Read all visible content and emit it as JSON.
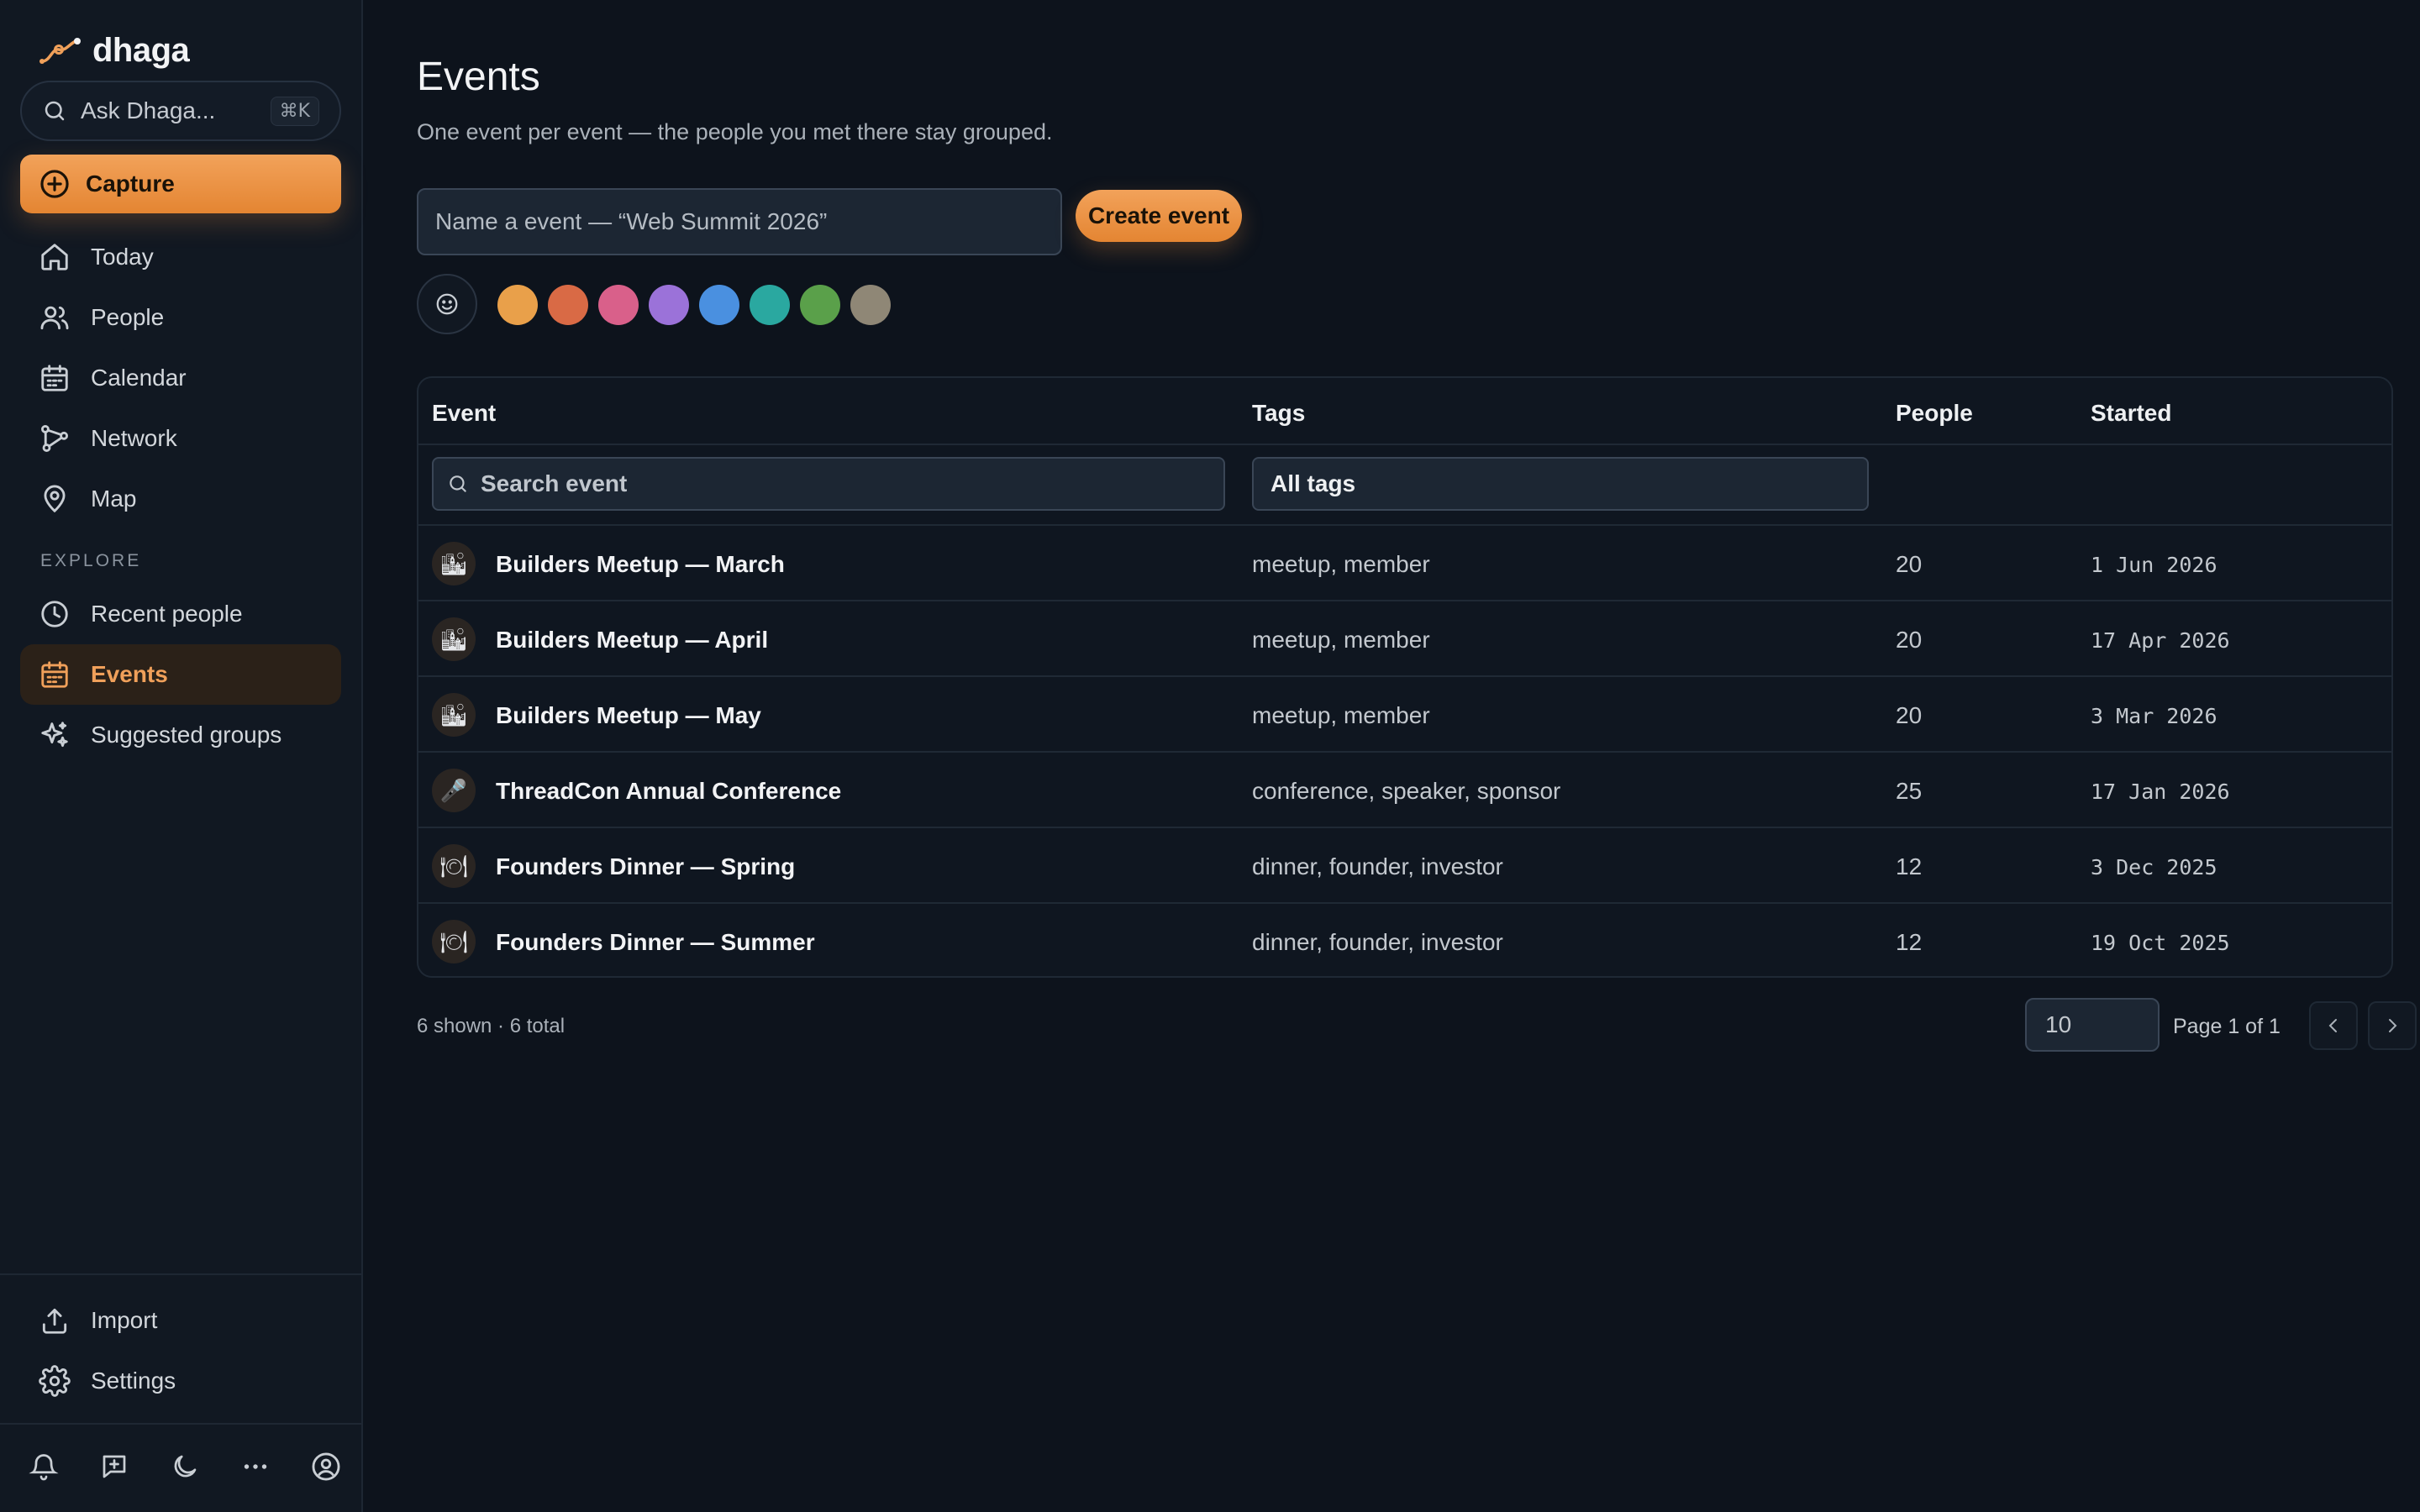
{
  "app": {
    "name": "dhaga"
  },
  "search": {
    "placeholder": "Ask Dhaga...",
    "shortcut": "⌘K"
  },
  "capture": {
    "label": "Capture"
  },
  "nav": {
    "today": "Today",
    "people": "People",
    "calendar": "Calendar",
    "network": "Network",
    "map": "Map"
  },
  "explore": {
    "section_label": "EXPLORE",
    "recent_people": "Recent people",
    "events": "Events",
    "suggested_groups": "Suggested groups"
  },
  "footer_nav": {
    "import": "Import",
    "settings": "Settings"
  },
  "colors": {
    "accent": "#f0a05a",
    "accent_dark": "#e48532",
    "background": "#0d131c",
    "sidebar": "#111822"
  },
  "page": {
    "title": "Events",
    "subtitle": "One event per event — the people you met there stay grouped."
  },
  "create": {
    "name_placeholder": "Name a event — “Web Summit 2026”",
    "button_label": "Create event",
    "emoji_icon": "smiley-icon",
    "swatches": [
      "#e9a04a",
      "#d96a45",
      "#d9608a",
      "#9b72d9",
      "#4a90e0",
      "#2aa8a0",
      "#5aa04a",
      "#8f8776"
    ]
  },
  "table": {
    "columns": {
      "event": "Event",
      "tags": "Tags",
      "people": "People",
      "started": "Started"
    },
    "search_placeholder": "Search event",
    "tags_filter": "All tags",
    "rows": [
      {
        "icon": "🏙",
        "name": "Builders Meetup — March",
        "tags": "meetup, member",
        "people": "20",
        "started": "1 Jun 2026"
      },
      {
        "icon": "🏙",
        "name": "Builders Meetup — April",
        "tags": "meetup, member",
        "people": "20",
        "started": "17 Apr 2026"
      },
      {
        "icon": "🏙",
        "name": "Builders Meetup — May",
        "tags": "meetup, member",
        "people": "20",
        "started": "3 Mar 2026"
      },
      {
        "icon": "🎤",
        "name": "ThreadCon Annual Conference",
        "tags": "conference, speaker, sponsor",
        "people": "25",
        "started": "17 Jan 2026"
      },
      {
        "icon": "🍽",
        "name": "Founders Dinner — Spring",
        "tags": "dinner, founder, investor",
        "people": "12",
        "started": "3 Dec 2025"
      },
      {
        "icon": "🍽",
        "name": "Founders Dinner — Summer",
        "tags": "dinner, founder, investor",
        "people": "12",
        "started": "19 Oct 2025"
      }
    ]
  },
  "pagination": {
    "count_text": "6 shown · 6 total",
    "page_size": "10",
    "page_info": "Page 1 of 1"
  }
}
